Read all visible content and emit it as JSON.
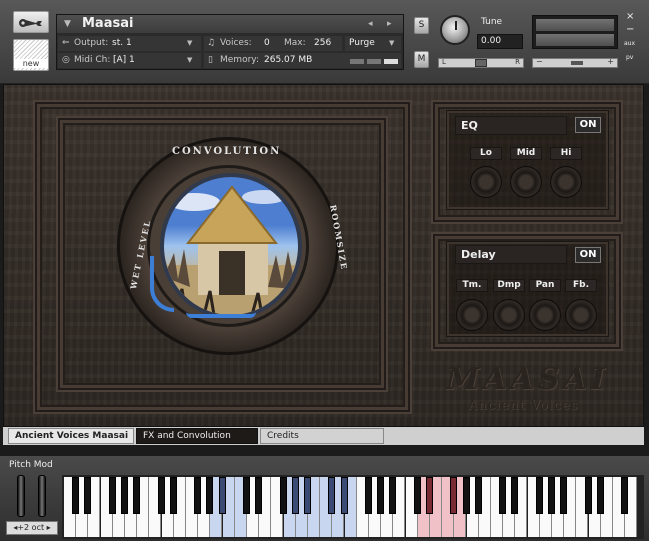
{
  "header": {
    "instrument_name": "Maasai",
    "output_label": "Output:",
    "output_value": "st. 1",
    "voices_label": "Voices:",
    "voices_value": "0",
    "max_label": "Max:",
    "max_value": "256",
    "purge_label": "Purge",
    "midi_label": "Midi Ch:",
    "midi_value": "[A]  1",
    "memory_label": "Memory:",
    "memory_value": "265.07 MB",
    "new_label": "new",
    "solo_label": "S",
    "mute_label": "M",
    "tune_label": "Tune",
    "tune_value": "0.00",
    "pan_left": "L",
    "pan_right": "R",
    "vol_minus": "−",
    "vol_plus": "+",
    "aux_label": "aux",
    "pv_label": "pv",
    "close_glyph": "×",
    "min_glyph": "−"
  },
  "convolution": {
    "top_text": "CONVOLUTION",
    "left_text": "WET LEVEL",
    "right_text": "ROOMSIZE"
  },
  "eq": {
    "title": "EQ",
    "on_label": "ON",
    "knobs": [
      "Lo",
      "Mid",
      "Hi"
    ]
  },
  "delay": {
    "title": "Delay",
    "on_label": "ON",
    "knobs": [
      "Tm.",
      "Dmp",
      "Pan",
      "Fb."
    ]
  },
  "brand": {
    "name": "MAASAI",
    "subtitle": "Ancient Voices"
  },
  "tabs": [
    {
      "label": "Ancient Voices Maasai",
      "active": true
    },
    {
      "label": "FX and Convolution",
      "active": false
    },
    {
      "label": "Credits",
      "active": false
    }
  ],
  "keyboard": {
    "pitch_mod_label": "Pitch Mod",
    "octave_label": "◂+2 oct ▸"
  },
  "colors": {
    "wood": "#332c27",
    "keyswitch_blue": "#c9d6ef",
    "keyswitch_red": "#f0c2c8"
  }
}
